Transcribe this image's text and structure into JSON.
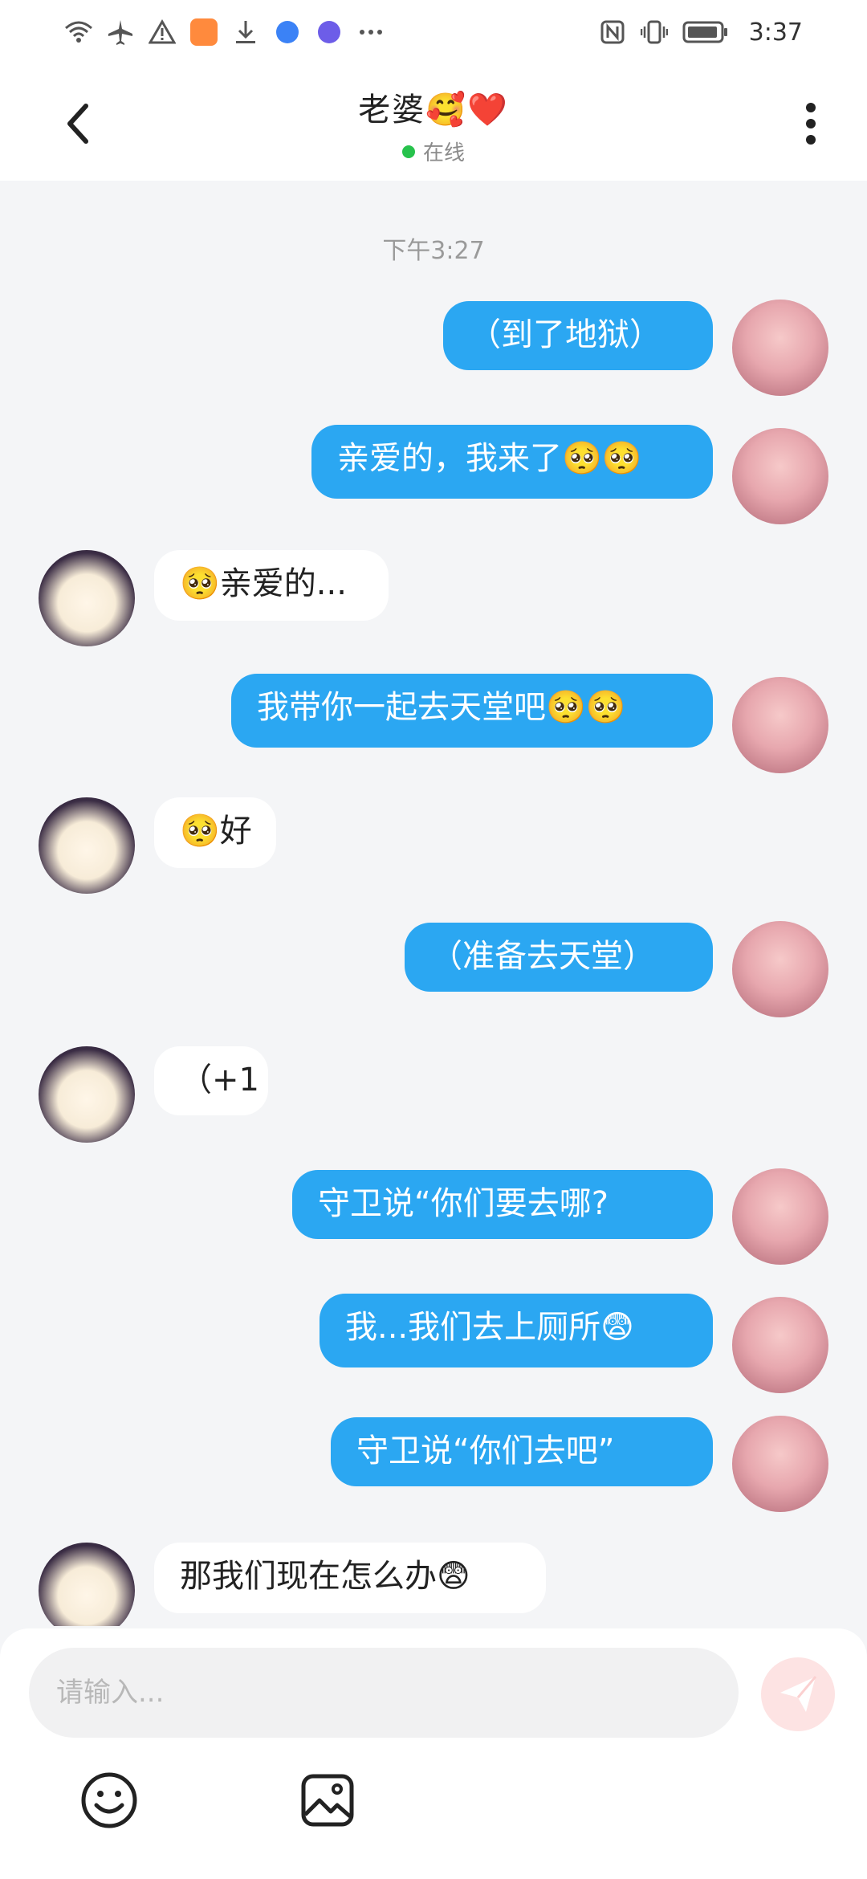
{
  "status_bar": {
    "time": "3:37",
    "icons": [
      "wifi-icon",
      "airplane-icon",
      "warning-icon",
      "video-app-icon",
      "download-icon",
      "browser-icon",
      "music-icon",
      "more-dots-icon",
      "nfc-icon",
      "vibrate-icon",
      "battery-icon"
    ]
  },
  "header": {
    "title": "老婆🥰❤️",
    "presence": "在线",
    "back_icon": "chevron-left-icon",
    "more_icon": "vertical-dots-icon"
  },
  "chat": {
    "timestamp": "下午3:27",
    "messages": [
      {
        "side": "right",
        "text": "（到了地狱）"
      },
      {
        "side": "right",
        "text": "亲爱的，我来了🥺🥺"
      },
      {
        "side": "left",
        "text": "🥺亲爱的..."
      },
      {
        "side": "right",
        "text": "我带你一起去天堂吧🥺🥺"
      },
      {
        "side": "left",
        "text": "🥺好"
      },
      {
        "side": "right",
        "text": "（准备去天堂）"
      },
      {
        "side": "left",
        "text": "（+1"
      },
      {
        "side": "right",
        "text": "守卫说“你们要去哪?"
      },
      {
        "side": "right",
        "text": "我...我们去上厕所😨"
      },
      {
        "side": "right",
        "text": "守卫说“你们去吧”"
      },
      {
        "side": "left",
        "text": "那我们现在怎么办😨"
      }
    ]
  },
  "composer": {
    "placeholder": "请输入...",
    "value": "",
    "send_icon": "send-plane-icon",
    "tools": [
      "emoji-icon",
      "image-icon"
    ]
  },
  "colors": {
    "accent_bubble": "#2ba7f2",
    "online_dot": "#27c24c",
    "send_button_bg": "#fde3e3"
  }
}
